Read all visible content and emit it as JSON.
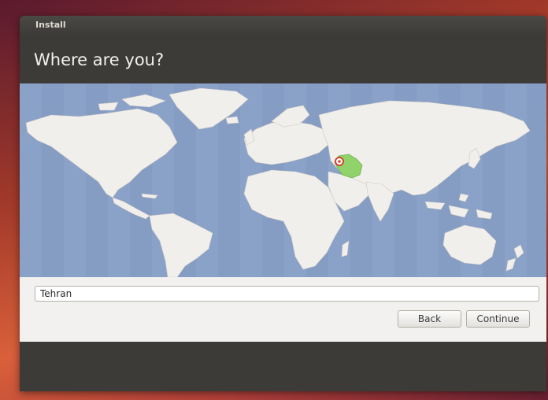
{
  "window": {
    "title": "Install"
  },
  "page": {
    "heading": "Where are you?"
  },
  "location": {
    "value": "Tehran"
  },
  "buttons": {
    "back": "Back",
    "continue": "Continue"
  },
  "colors": {
    "ocean": "#8aa1c8",
    "land": "#f1efec",
    "selected_region": "#8fd36a",
    "pin": "#d6452f"
  },
  "map": {
    "selected_country": "Iran",
    "pin_icon": "location-pin-icon"
  }
}
